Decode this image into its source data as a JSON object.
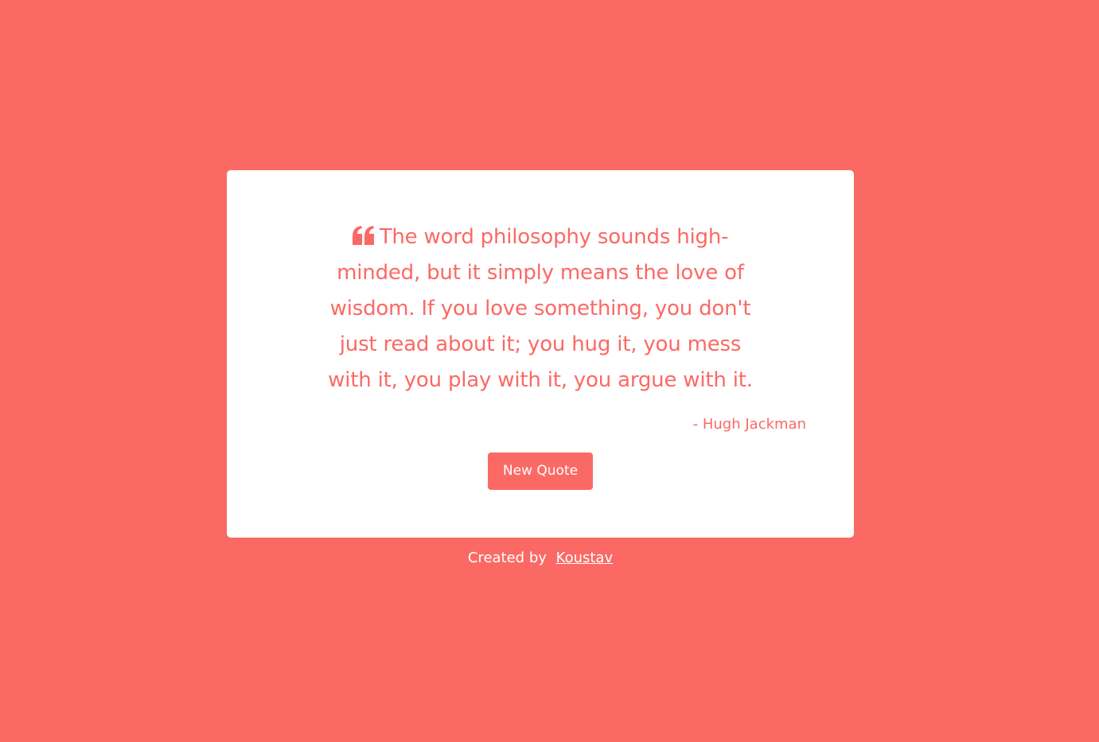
{
  "quote": {
    "text": "The word philosophy sounds high-minded, but it simply means the love of wisdom. If you love something, you don't just read about it; you hug it, you mess with it, you play with it, you argue with it.",
    "author": "- Hugh Jackman",
    "icon": "quote-left-icon"
  },
  "actions": {
    "new_quote_label": "New Quote"
  },
  "footer": {
    "prefix": "Created by",
    "author_link": "Koustav"
  },
  "colors": {
    "accent": "#fb6964",
    "card": "#ffffff",
    "text_on_accent": "#ffffff"
  }
}
